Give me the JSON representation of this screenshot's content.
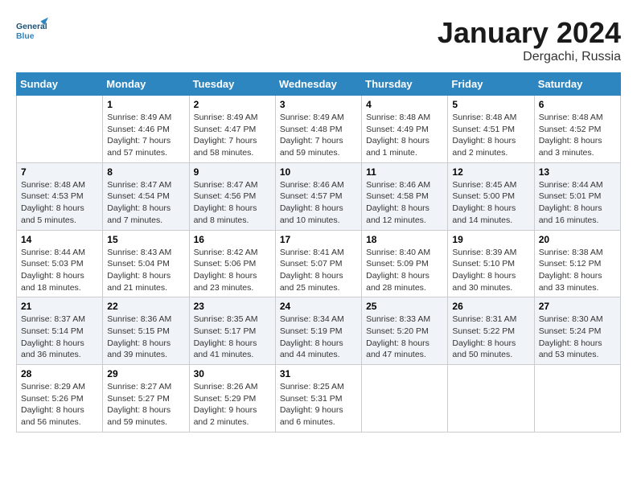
{
  "header": {
    "logo_general": "General",
    "logo_blue": "Blue",
    "month_title": "January 2024",
    "location": "Dergachi, Russia"
  },
  "weekdays": [
    "Sunday",
    "Monday",
    "Tuesday",
    "Wednesday",
    "Thursday",
    "Friday",
    "Saturday"
  ],
  "weeks": [
    [
      {
        "day": "",
        "sunrise": "",
        "sunset": "",
        "daylight": ""
      },
      {
        "day": "1",
        "sunrise": "Sunrise: 8:49 AM",
        "sunset": "Sunset: 4:46 PM",
        "daylight": "Daylight: 7 hours and 57 minutes."
      },
      {
        "day": "2",
        "sunrise": "Sunrise: 8:49 AM",
        "sunset": "Sunset: 4:47 PM",
        "daylight": "Daylight: 7 hours and 58 minutes."
      },
      {
        "day": "3",
        "sunrise": "Sunrise: 8:49 AM",
        "sunset": "Sunset: 4:48 PM",
        "daylight": "Daylight: 7 hours and 59 minutes."
      },
      {
        "day": "4",
        "sunrise": "Sunrise: 8:48 AM",
        "sunset": "Sunset: 4:49 PM",
        "daylight": "Daylight: 8 hours and 1 minute."
      },
      {
        "day": "5",
        "sunrise": "Sunrise: 8:48 AM",
        "sunset": "Sunset: 4:51 PM",
        "daylight": "Daylight: 8 hours and 2 minutes."
      },
      {
        "day": "6",
        "sunrise": "Sunrise: 8:48 AM",
        "sunset": "Sunset: 4:52 PM",
        "daylight": "Daylight: 8 hours and 3 minutes."
      }
    ],
    [
      {
        "day": "7",
        "sunrise": "Sunrise: 8:48 AM",
        "sunset": "Sunset: 4:53 PM",
        "daylight": "Daylight: 8 hours and 5 minutes."
      },
      {
        "day": "8",
        "sunrise": "Sunrise: 8:47 AM",
        "sunset": "Sunset: 4:54 PM",
        "daylight": "Daylight: 8 hours and 7 minutes."
      },
      {
        "day": "9",
        "sunrise": "Sunrise: 8:47 AM",
        "sunset": "Sunset: 4:56 PM",
        "daylight": "Daylight: 8 hours and 8 minutes."
      },
      {
        "day": "10",
        "sunrise": "Sunrise: 8:46 AM",
        "sunset": "Sunset: 4:57 PM",
        "daylight": "Daylight: 8 hours and 10 minutes."
      },
      {
        "day": "11",
        "sunrise": "Sunrise: 8:46 AM",
        "sunset": "Sunset: 4:58 PM",
        "daylight": "Daylight: 8 hours and 12 minutes."
      },
      {
        "day": "12",
        "sunrise": "Sunrise: 8:45 AM",
        "sunset": "Sunset: 5:00 PM",
        "daylight": "Daylight: 8 hours and 14 minutes."
      },
      {
        "day": "13",
        "sunrise": "Sunrise: 8:44 AM",
        "sunset": "Sunset: 5:01 PM",
        "daylight": "Daylight: 8 hours and 16 minutes."
      }
    ],
    [
      {
        "day": "14",
        "sunrise": "Sunrise: 8:44 AM",
        "sunset": "Sunset: 5:03 PM",
        "daylight": "Daylight: 8 hours and 18 minutes."
      },
      {
        "day": "15",
        "sunrise": "Sunrise: 8:43 AM",
        "sunset": "Sunset: 5:04 PM",
        "daylight": "Daylight: 8 hours and 21 minutes."
      },
      {
        "day": "16",
        "sunrise": "Sunrise: 8:42 AM",
        "sunset": "Sunset: 5:06 PM",
        "daylight": "Daylight: 8 hours and 23 minutes."
      },
      {
        "day": "17",
        "sunrise": "Sunrise: 8:41 AM",
        "sunset": "Sunset: 5:07 PM",
        "daylight": "Daylight: 8 hours and 25 minutes."
      },
      {
        "day": "18",
        "sunrise": "Sunrise: 8:40 AM",
        "sunset": "Sunset: 5:09 PM",
        "daylight": "Daylight: 8 hours and 28 minutes."
      },
      {
        "day": "19",
        "sunrise": "Sunrise: 8:39 AM",
        "sunset": "Sunset: 5:10 PM",
        "daylight": "Daylight: 8 hours and 30 minutes."
      },
      {
        "day": "20",
        "sunrise": "Sunrise: 8:38 AM",
        "sunset": "Sunset: 5:12 PM",
        "daylight": "Daylight: 8 hours and 33 minutes."
      }
    ],
    [
      {
        "day": "21",
        "sunrise": "Sunrise: 8:37 AM",
        "sunset": "Sunset: 5:14 PM",
        "daylight": "Daylight: 8 hours and 36 minutes."
      },
      {
        "day": "22",
        "sunrise": "Sunrise: 8:36 AM",
        "sunset": "Sunset: 5:15 PM",
        "daylight": "Daylight: 8 hours and 39 minutes."
      },
      {
        "day": "23",
        "sunrise": "Sunrise: 8:35 AM",
        "sunset": "Sunset: 5:17 PM",
        "daylight": "Daylight: 8 hours and 41 minutes."
      },
      {
        "day": "24",
        "sunrise": "Sunrise: 8:34 AM",
        "sunset": "Sunset: 5:19 PM",
        "daylight": "Daylight: 8 hours and 44 minutes."
      },
      {
        "day": "25",
        "sunrise": "Sunrise: 8:33 AM",
        "sunset": "Sunset: 5:20 PM",
        "daylight": "Daylight: 8 hours and 47 minutes."
      },
      {
        "day": "26",
        "sunrise": "Sunrise: 8:31 AM",
        "sunset": "Sunset: 5:22 PM",
        "daylight": "Daylight: 8 hours and 50 minutes."
      },
      {
        "day": "27",
        "sunrise": "Sunrise: 8:30 AM",
        "sunset": "Sunset: 5:24 PM",
        "daylight": "Daylight: 8 hours and 53 minutes."
      }
    ],
    [
      {
        "day": "28",
        "sunrise": "Sunrise: 8:29 AM",
        "sunset": "Sunset: 5:26 PM",
        "daylight": "Daylight: 8 hours and 56 minutes."
      },
      {
        "day": "29",
        "sunrise": "Sunrise: 8:27 AM",
        "sunset": "Sunset: 5:27 PM",
        "daylight": "Daylight: 8 hours and 59 minutes."
      },
      {
        "day": "30",
        "sunrise": "Sunrise: 8:26 AM",
        "sunset": "Sunset: 5:29 PM",
        "daylight": "Daylight: 9 hours and 2 minutes."
      },
      {
        "day": "31",
        "sunrise": "Sunrise: 8:25 AM",
        "sunset": "Sunset: 5:31 PM",
        "daylight": "Daylight: 9 hours and 6 minutes."
      },
      {
        "day": "",
        "sunrise": "",
        "sunset": "",
        "daylight": ""
      },
      {
        "day": "",
        "sunrise": "",
        "sunset": "",
        "daylight": ""
      },
      {
        "day": "",
        "sunrise": "",
        "sunset": "",
        "daylight": ""
      }
    ]
  ]
}
